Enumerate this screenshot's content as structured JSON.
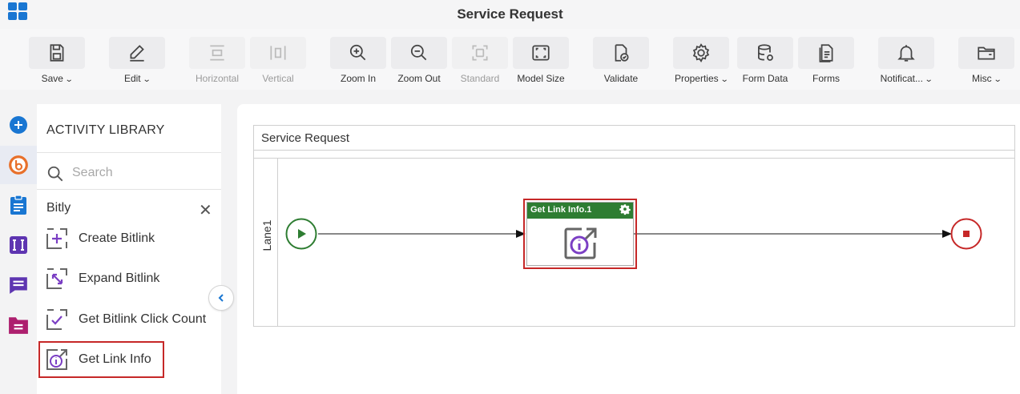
{
  "header": {
    "title": "Service Request"
  },
  "toolbar": {
    "save": "Save",
    "edit": "Edit",
    "horizontal": "Horizontal",
    "vertical": "Vertical",
    "zoom_in": "Zoom In",
    "zoom_out": "Zoom Out",
    "standard": "Standard",
    "model_size": "Model Size",
    "validate": "Validate",
    "properties": "Properties",
    "form_data": "Form Data",
    "forms": "Forms",
    "notifications": "Notificat...",
    "misc": "Misc"
  },
  "library": {
    "title": "ACTIVITY LIBRARY",
    "search_placeholder": "Search",
    "group": "Bitly",
    "items": [
      {
        "label": "Create Bitlink"
      },
      {
        "label": "Expand Bitlink"
      },
      {
        "label": "Get Bitlink Click Count"
      },
      {
        "label": "Get Link Info"
      }
    ]
  },
  "canvas": {
    "pool_title": "Service Request",
    "lane_label": "Lane1",
    "task_title": "Get Link Info.1"
  },
  "colors": {
    "accent": "#1976d2",
    "task_header": "#2e7d32",
    "selection": "#c62828",
    "start_event": "#2e7d32",
    "end_event": "#c62828",
    "activity_icon": "#7b3fc4"
  }
}
